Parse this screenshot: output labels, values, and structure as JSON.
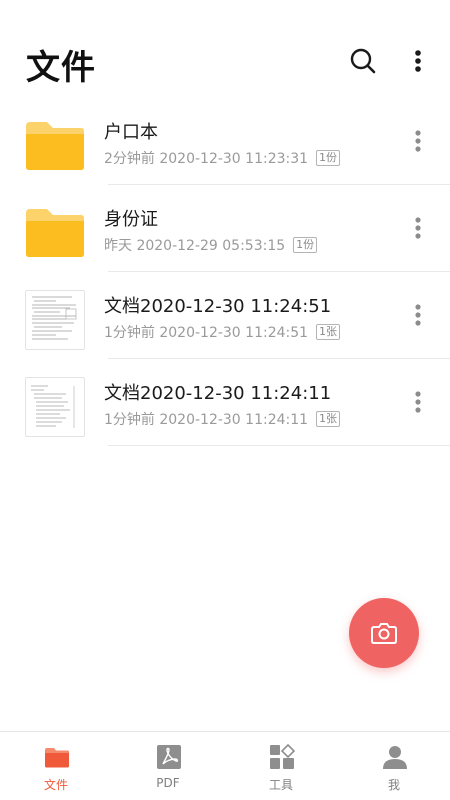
{
  "header": {
    "title": "文件",
    "search_icon": "search-icon",
    "more_icon": "more-vertical-icon"
  },
  "files": [
    {
      "type": "folder",
      "name": "户口本",
      "time": "2分钟前 2020-12-30 11:23:31",
      "badge": "1份"
    },
    {
      "type": "folder",
      "name": "身份证",
      "time": "昨天 2020-12-29 05:53:15",
      "badge": "1份"
    },
    {
      "type": "document",
      "name": "文档2020-12-30 11:24:51",
      "time": "1分钟前 2020-12-30 11:24:51",
      "badge": "1张"
    },
    {
      "type": "document",
      "name": "文档2020-12-30 11:24:11",
      "time": "1分钟前 2020-12-30 11:24:11",
      "badge": "1张"
    }
  ],
  "fab": {
    "icon": "camera-icon",
    "color": "#f06363"
  },
  "tabbar": {
    "active_color": "#f05a3a",
    "inactive_color": "#7f7f7f",
    "tabs": [
      {
        "label": "文件",
        "icon": "folder-icon",
        "active": true
      },
      {
        "label": "PDF",
        "icon": "pdf-icon",
        "active": false
      },
      {
        "label": "工具",
        "icon": "tools-icon",
        "active": false
      },
      {
        "label": "我",
        "icon": "person-icon",
        "active": false
      }
    ]
  }
}
